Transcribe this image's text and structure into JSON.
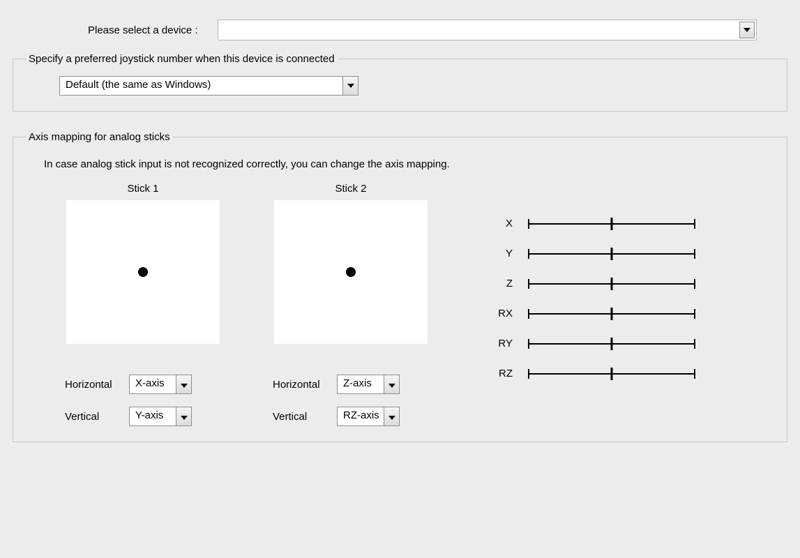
{
  "device": {
    "label": "Please select a device :",
    "value": ""
  },
  "joystick_group": {
    "legend": "Specify a preferred joystick number when this device is connected",
    "value": "Default (the same as Windows)"
  },
  "axis_group": {
    "legend": "Axis mapping for analog sticks",
    "description": "In case analog stick input is not recognized correctly, you can change the axis mapping.",
    "sticks": [
      {
        "title": "Stick 1",
        "horizontal_label": "Horizontal",
        "vertical_label": "Vertical",
        "horizontal_value": "X-axis",
        "vertical_value": "Y-axis"
      },
      {
        "title": "Stick 2",
        "horizontal_label": "Horizontal",
        "vertical_label": "Vertical",
        "horizontal_value": "Z-axis",
        "vertical_value": "RZ-axis"
      }
    ],
    "sliders": [
      {
        "label": "X"
      },
      {
        "label": "Y"
      },
      {
        "label": "Z"
      },
      {
        "label": "RX"
      },
      {
        "label": "RY"
      },
      {
        "label": "RZ"
      }
    ]
  }
}
